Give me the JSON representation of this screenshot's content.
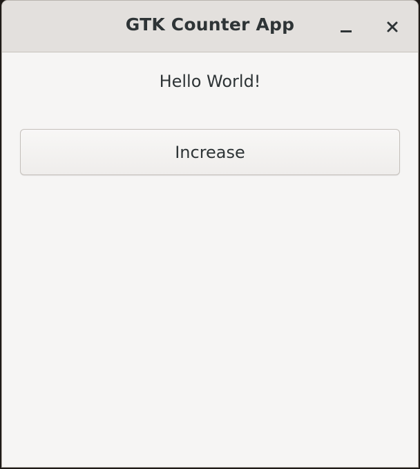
{
  "window": {
    "title": "GTK Counter App",
    "controls": {
      "minimize_icon": "minimize-icon",
      "close_icon": "close-icon"
    }
  },
  "content": {
    "label": "Hello World!",
    "button_label": "Increase"
  },
  "colors": {
    "titlebar_bg": "#e3e0dd",
    "window_bg": "#f6f5f4",
    "text": "#2e3436"
  }
}
